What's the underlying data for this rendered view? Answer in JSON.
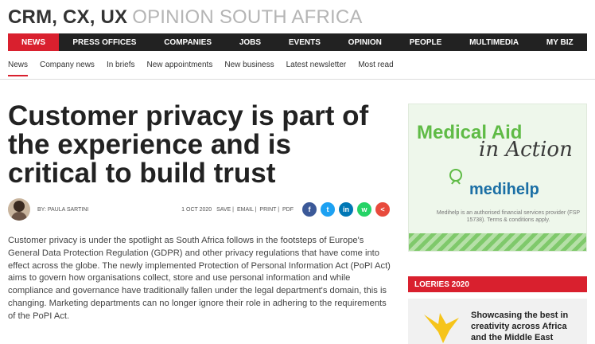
{
  "site": {
    "title_bold": "CRM, CX, UX",
    "title_light": "OPINION SOUTH AFRICA"
  },
  "main_nav": [
    {
      "label": "NEWS",
      "active": true
    },
    {
      "label": "PRESS OFFICES"
    },
    {
      "label": "COMPANIES"
    },
    {
      "label": "JOBS"
    },
    {
      "label": "EVENTS"
    },
    {
      "label": "OPINION"
    },
    {
      "label": "PEOPLE"
    },
    {
      "label": "MULTIMEDIA"
    },
    {
      "label": "MY BIZ"
    }
  ],
  "sub_nav": [
    {
      "label": "News",
      "active": true
    },
    {
      "label": "Company news"
    },
    {
      "label": "In briefs"
    },
    {
      "label": "New appointments"
    },
    {
      "label": "New business"
    },
    {
      "label": "Latest newsletter"
    },
    {
      "label": "Most read"
    }
  ],
  "article": {
    "headline": "Customer privacy is part of the experience and is critical to build trust",
    "author": "BY: PAULA SARTINI",
    "date": "1 OCT 2020",
    "actions": [
      "SAVE",
      "EMAIL",
      "PRINT",
      "PDF"
    ],
    "body": "Customer privacy is under the spotlight as South Africa follows in the footsteps of Europe's General Data Protection Regulation (GDPR) and other privacy regulations that have come into effect across the globe. The newly implemented Protection of Personal Information Act (PoPI Act) aims to govern how organisations collect, store and use personal information and while compliance and governance have traditionally fallen under the legal department's domain, this is changing. Marketing departments can no longer ignore their role in adhering to the requirements of the PoPI Act."
  },
  "socials": [
    {
      "name": "facebook-icon",
      "glyph": "f",
      "color": "#3b5998"
    },
    {
      "name": "twitter-icon",
      "glyph": "t",
      "color": "#1da1f2"
    },
    {
      "name": "linkedin-icon",
      "glyph": "in",
      "color": "#0077b5"
    },
    {
      "name": "whatsapp-icon",
      "glyph": "w",
      "color": "#25d366"
    },
    {
      "name": "share-icon",
      "glyph": "<",
      "color": "#e84a3c"
    }
  ],
  "ad": {
    "line1": "Medical Aid",
    "line2": "in Action",
    "brand": "medihelp",
    "disclaimer": "Medihelp is an authorised financial services provider (FSP 15738). Terms & conditions apply."
  },
  "sidebar": {
    "section_label": "LOERIES 2020",
    "promo_title": "Showcasing the best in creativity across Africa and the Middle East"
  },
  "colors": {
    "accent": "#d9202e",
    "nav_bg": "#222222",
    "ad_green": "#5fbb46",
    "ad_blue": "#1b6fa5"
  }
}
